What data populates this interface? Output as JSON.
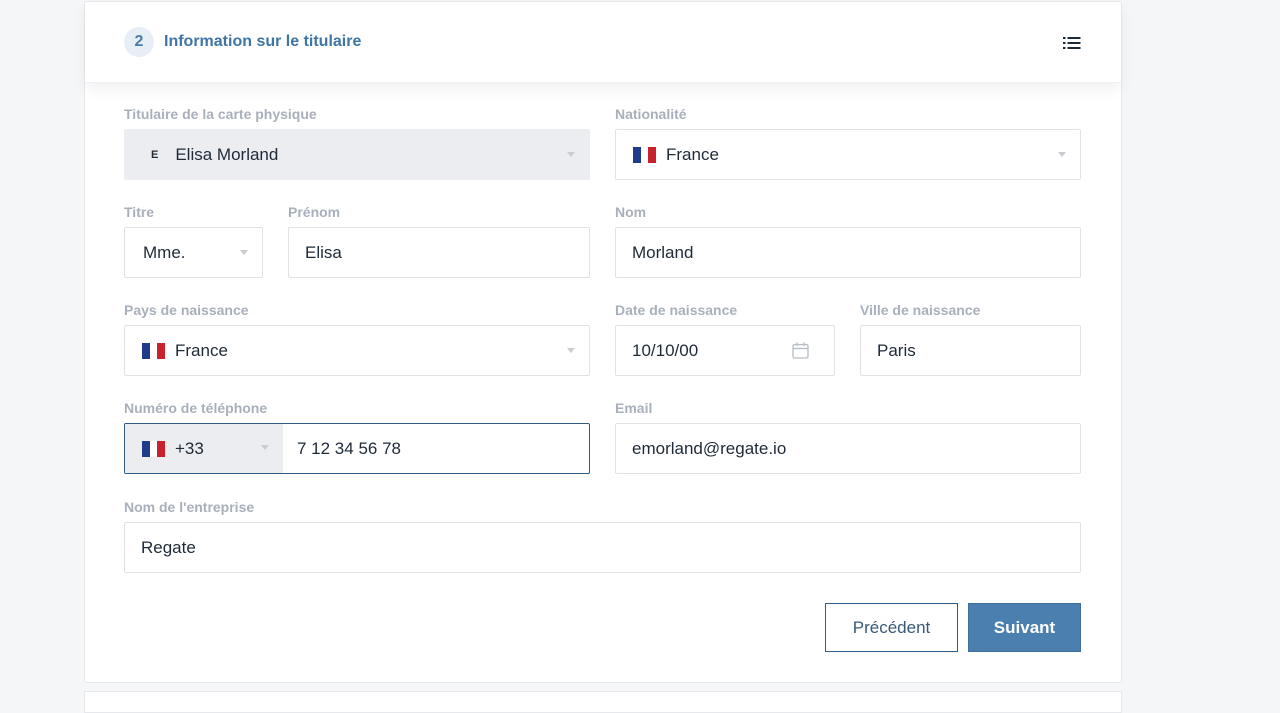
{
  "header": {
    "step": "2",
    "title": "Information sur le titulaire",
    "menu_icon": "list-icon"
  },
  "holder": {
    "label": "Titulaire de la carte physique",
    "initial": "E",
    "value": "Elisa Morland"
  },
  "nationality": {
    "label": "Nationalité",
    "value": "France",
    "flag_icon": "france-flag-icon"
  },
  "title_field": {
    "label": "Titre",
    "value": "Mme."
  },
  "first_name": {
    "label": "Prénom",
    "value": "Elisa"
  },
  "last_name": {
    "label": "Nom",
    "value": "Morland"
  },
  "birth_country": {
    "label": "Pays de naissance",
    "value": "France",
    "flag_icon": "france-flag-icon"
  },
  "birth_date": {
    "label": "Date de naissance",
    "value": "10/10/00",
    "icon": "calendar-icon"
  },
  "birth_city": {
    "label": "Ville de naissance",
    "value": "Paris"
  },
  "phone": {
    "label": "Numéro de téléphone",
    "code": "+33",
    "value": "7 12 34 56 78",
    "flag_icon": "france-flag-icon"
  },
  "email": {
    "label": "Email",
    "value": "emorland@regate.io"
  },
  "company": {
    "label": "Nom de l'entreprise",
    "value": "Regate"
  },
  "buttons": {
    "previous": "Précédent",
    "next": "Suivant"
  },
  "colors": {
    "accent": "#4a7faf",
    "title": "#3f75a5",
    "flag_blue": "#1f3b8a",
    "flag_red": "#c8232c",
    "focus_border": "#2f5b86"
  }
}
